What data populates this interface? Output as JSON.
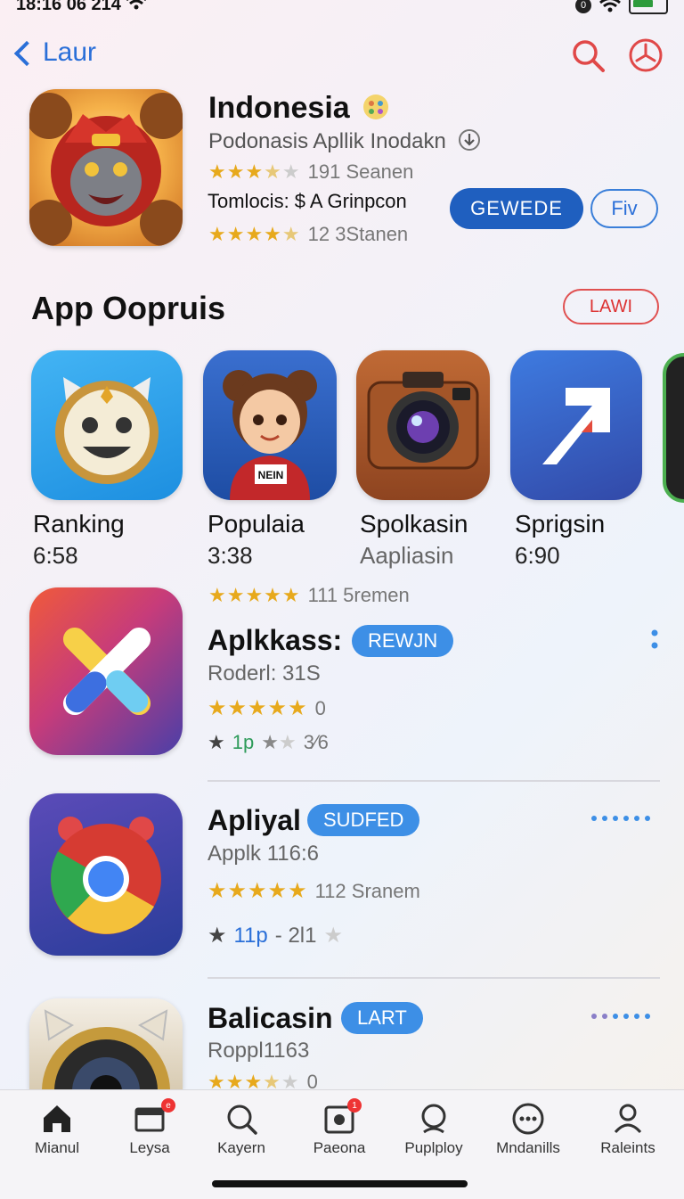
{
  "status_bar": {
    "time": "18:16 06 214",
    "sim": "0"
  },
  "nav": {
    "back_label": "Laur"
  },
  "hero": {
    "title": "Indonesia",
    "subtitle": "Podonasis Apllik Inodakn",
    "rating1_text": "191 Seanen",
    "promo_text": "Tomlocis: $ A Grinpcon",
    "rating2_text": "12 3Stanen",
    "primary_button": "GEWEDE",
    "secondary_button": "Fiv"
  },
  "section": {
    "title": "App Oopruis",
    "action": "LAWI"
  },
  "carousel": [
    {
      "name": "Ranking",
      "sub": "6:58"
    },
    {
      "name": "Populaia",
      "sub": "3:38"
    },
    {
      "name": "Spolkasin",
      "sub": "Aapliasin"
    },
    {
      "name": "Sprigsin",
      "sub": "6:90"
    }
  ],
  "carousel_art": {
    "kid_shirt": "NEIN"
  },
  "top_rating": "111 5remen",
  "list": [
    {
      "title": "Aplkkass:",
      "badge": "REWJN",
      "sub": "Roderl: 31S",
      "rating_text": "0",
      "meta_a": "1p",
      "meta_b": "3⁄6"
    },
    {
      "title": "Apliyal",
      "badge": "SUDFED",
      "sub": "Applk 116:6",
      "rating_text": "112 Sranem",
      "meta_a": "11p",
      "meta_b": "- 2l1"
    },
    {
      "title": "Balicasin",
      "badge": "LART",
      "sub": "Roppl1163",
      "rating_text": "0"
    }
  ],
  "tabs": [
    {
      "label": "Mianul"
    },
    {
      "label": "Leysa",
      "badge": "e"
    },
    {
      "label": "Kayern"
    },
    {
      "label": "Paeona",
      "badge": "1"
    },
    {
      "label": "Puplploy"
    },
    {
      "label": "Mndanills"
    },
    {
      "label": "Raleints"
    }
  ],
  "colors": {
    "accent": "#2a6fd8",
    "primary_button": "#1f5fbf",
    "badge": "#3d8fe6",
    "star": "#e7a91c",
    "danger": "#e05050"
  }
}
